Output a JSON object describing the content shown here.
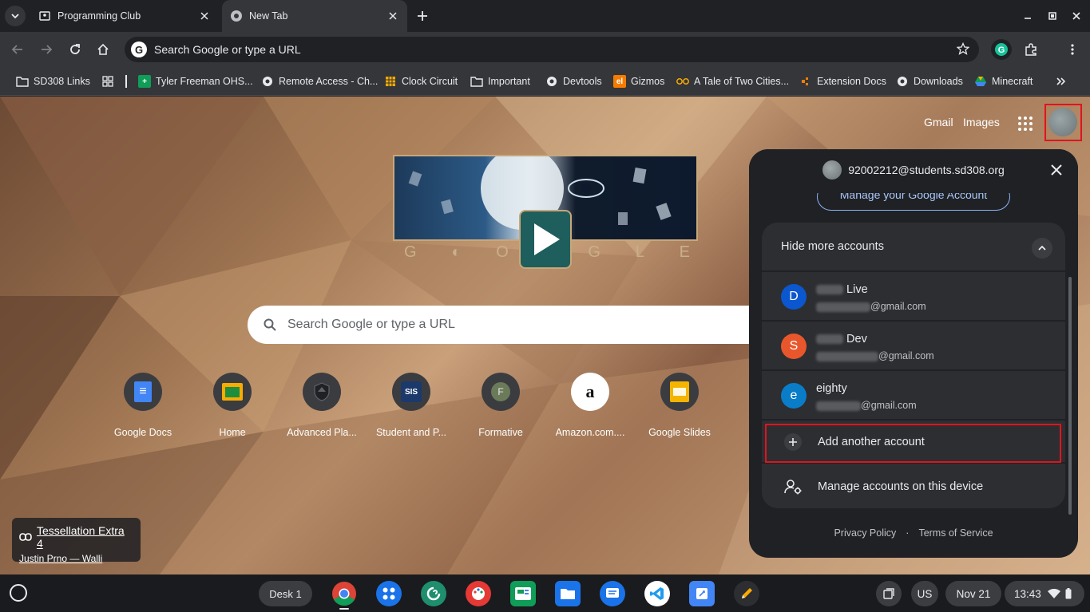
{
  "tabs": [
    {
      "title": "Programming Club",
      "icon": "classroom-icon"
    },
    {
      "title": "New Tab",
      "icon": "chrome-icon"
    }
  ],
  "omnibox": {
    "placeholder": "Search Google or type a URL"
  },
  "bookmarks": [
    {
      "label": "SD308 Links",
      "icon": "folder-icon"
    },
    {
      "label": "",
      "icon": "apps-grid-icon"
    },
    {
      "label": "Tyler Freeman OHS...",
      "icon": "sheets-icon"
    },
    {
      "label": "Remote Access - Ch...",
      "icon": "globe-icon"
    },
    {
      "label": "Clock Circuit",
      "icon": "grid-icon"
    },
    {
      "label": "Important",
      "icon": "folder-icon"
    },
    {
      "label": "Devtools",
      "icon": "globe-icon"
    },
    {
      "label": "Gizmos",
      "icon": "gizmos-icon"
    },
    {
      "label": "A Tale of Two Cities...",
      "icon": "book-icon"
    },
    {
      "label": "Extension Docs",
      "icon": "puzzle-icon"
    },
    {
      "label": "Downloads",
      "icon": "globe-icon"
    },
    {
      "label": "Minecraft",
      "icon": "drive-icon"
    }
  ],
  "toplinks": {
    "gmail": "Gmail",
    "images": "Images"
  },
  "doodle": {
    "letters": [
      "G",
      "◐",
      "O",
      "◑",
      "G",
      "L",
      "E"
    ]
  },
  "ntp_search": {
    "placeholder": "Search Google or type a URL"
  },
  "shortcuts": [
    {
      "label": "Google Docs",
      "icon": "docs-icon",
      "glyph": "≡",
      "color": "#4285f4"
    },
    {
      "label": "Home",
      "icon": "classroom-icon",
      "glyph": "▣",
      "color": "#f9ab00"
    },
    {
      "label": "Advanced Pla...",
      "icon": "shield-icon",
      "glyph": "⬡",
      "color": "#202124"
    },
    {
      "label": "Student and P...",
      "icon": "sis-icon",
      "glyph": "SIS",
      "color": "#1b3a6b"
    },
    {
      "label": "Formative",
      "icon": "formative-icon",
      "glyph": "F",
      "color": "#6b7b5a"
    },
    {
      "label": "Amazon.com....",
      "icon": "amazon-icon",
      "glyph": "a",
      "color": "#ffffff"
    },
    {
      "label": "Google Slides",
      "icon": "slides-icon",
      "glyph": "▭",
      "color": "#f4b400"
    }
  ],
  "attribution": {
    "title": "Tessellation Extra 4",
    "author": "Justin Prno — Walli"
  },
  "account_panel": {
    "email": "92002212@students.sd308.org",
    "manage_google_account": "Manage your Google Account",
    "hide_more": "Hide more accounts",
    "accounts": [
      {
        "initial": "D",
        "name": "Live",
        "email": "@gmail.com",
        "color": "#0b57d0"
      },
      {
        "initial": "S",
        "name": "Dev",
        "email": "@gmail.com",
        "color": "#e8572c"
      },
      {
        "initial": "e",
        "name": "eighty",
        "email": "@gmail.com",
        "color": "#0a7dc9"
      }
    ],
    "add_account": "Add another account",
    "manage_device": "Manage accounts on this device",
    "privacy": "Privacy Policy",
    "terms": "Terms of Service",
    "separator": "·"
  },
  "shelf": {
    "desk": "Desk 1",
    "ime": "US",
    "date": "Nov 21",
    "time": "13:43",
    "apps": [
      {
        "icon": "chrome-icon",
        "color": "#db4437"
      },
      {
        "icon": "app-launcher-icon",
        "color": "#1a73e8"
      },
      {
        "icon": "pear-icon",
        "color": "#1e8e6e"
      },
      {
        "icon": "canvas-icon",
        "color": "#e53935"
      },
      {
        "icon": "classroom-icon",
        "color": "#0f9d58"
      },
      {
        "icon": "files-icon",
        "color": "#1a73e8"
      },
      {
        "icon": "messages-icon",
        "color": "#1a73e8"
      },
      {
        "icon": "vscode-icon",
        "color": "#ffffff"
      },
      {
        "icon": "screencast-icon",
        "color": "#4285f4"
      },
      {
        "icon": "pencil-icon",
        "color": "#2d2e31"
      }
    ]
  }
}
